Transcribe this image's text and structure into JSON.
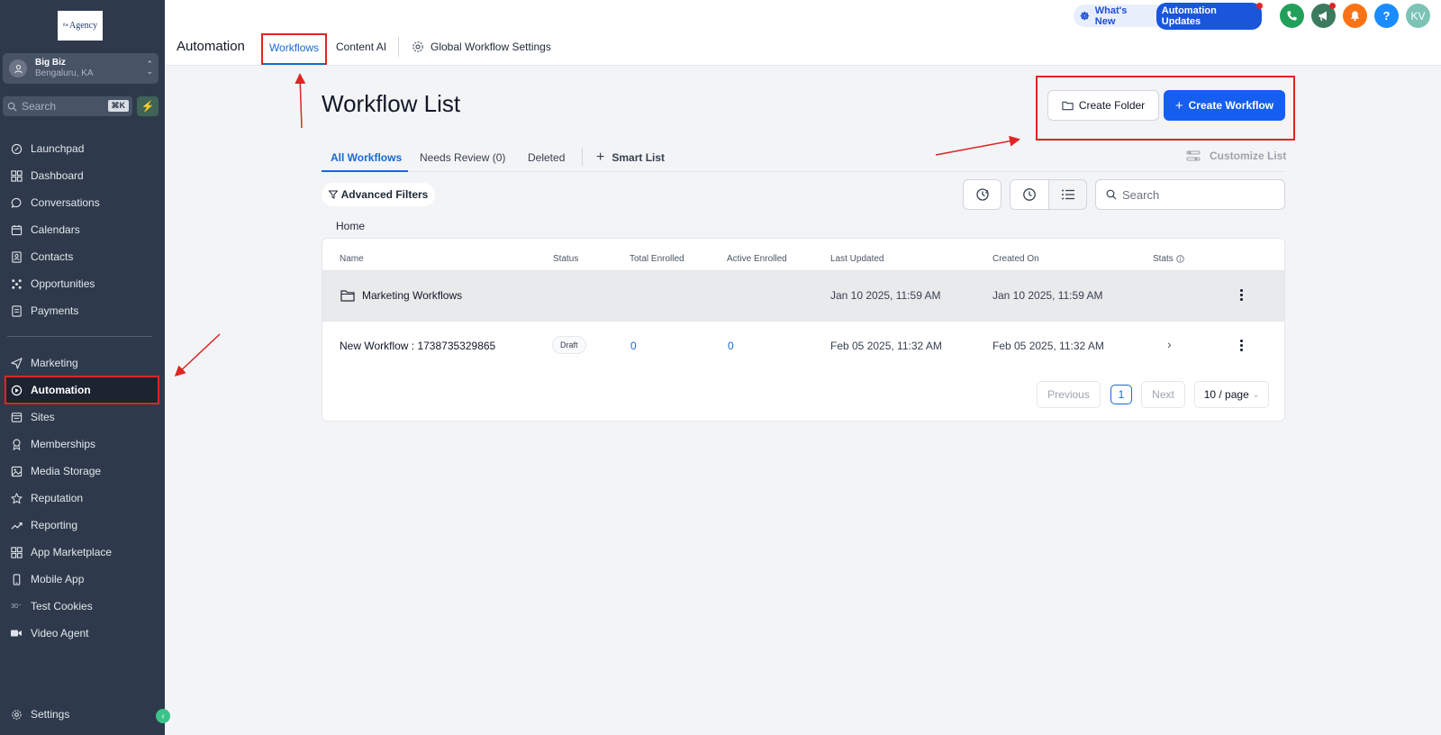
{
  "sidebar": {
    "logo_text": "Agency",
    "logo_sup": "the",
    "account": {
      "name": "Big Biz",
      "location": "Bengaluru, KA"
    },
    "search": {
      "placeholder": "Search",
      "shortcut": "⌘K"
    },
    "items": [
      {
        "label": "Launchpad",
        "icon": "rocket-icon"
      },
      {
        "label": "Dashboard",
        "icon": "dashboard-icon"
      },
      {
        "label": "Conversations",
        "icon": "chat-icon"
      },
      {
        "label": "Calendars",
        "icon": "calendar-icon"
      },
      {
        "label": "Contacts",
        "icon": "contacts-icon"
      },
      {
        "label": "Opportunities",
        "icon": "opportunities-icon"
      },
      {
        "label": "Payments",
        "icon": "payments-icon"
      },
      {
        "label": "Marketing",
        "icon": "send-icon"
      },
      {
        "label": "Automation",
        "icon": "automation-icon",
        "active": true
      },
      {
        "label": "Sites",
        "icon": "sites-icon"
      },
      {
        "label": "Memberships",
        "icon": "award-icon"
      },
      {
        "label": "Media Storage",
        "icon": "image-icon"
      },
      {
        "label": "Reputation",
        "icon": "star-icon"
      },
      {
        "label": "Reporting",
        "icon": "trend-icon"
      },
      {
        "label": "App Marketplace",
        "icon": "apps-icon"
      },
      {
        "label": "Mobile App",
        "icon": "mobile-icon"
      },
      {
        "label": "Test Cookies",
        "icon": "cookie-icon"
      },
      {
        "label": "Video Agent",
        "icon": "video-icon"
      }
    ],
    "settings_label": "Settings"
  },
  "topbar": {
    "page_label": "Automation",
    "tabs": [
      "Workflows",
      "Content AI",
      "Global Workflow Settings"
    ],
    "whats_new": "What's New",
    "automation_updates": "Automation Updates",
    "avatar_initials": "KV",
    "help_glyph": "?",
    "colors": {
      "phone": "#22a05a",
      "megaphone": "#3b7a5e",
      "bell": "#f97316",
      "help": "#1a8cff",
      "avatar": "#7cc3b6"
    }
  },
  "main": {
    "title": "Workflow List",
    "create_folder": "Create Folder",
    "create_workflow": "Create Workflow",
    "subtabs": [
      "All Workflows",
      "Needs Review (0)",
      "Deleted"
    ],
    "smart_list": "Smart List",
    "customize_list": "Customize List",
    "advanced_filters": "Advanced Filters",
    "search_placeholder": "Search",
    "breadcrumb": "Home",
    "table": {
      "headers": [
        "Name",
        "Status",
        "Total Enrolled",
        "Active Enrolled",
        "Last Updated",
        "Created On",
        "Stats"
      ],
      "folder_row": {
        "name": "Marketing Workflows",
        "last_updated": "Jan 10 2025, 11:59 AM",
        "created_on": "Jan 10 2025, 11:59 AM"
      },
      "workflow_row": {
        "name": "New Workflow : 1738735329865",
        "status": "Draft",
        "total_enrolled": "0",
        "active_enrolled": "0",
        "last_updated": "Feb 05 2025, 11:32 AM",
        "created_on": "Feb 05 2025, 11:32 AM"
      }
    },
    "pagination": {
      "previous": "Previous",
      "page": "1",
      "next": "Next",
      "page_size": "10 / page"
    }
  },
  "accent_colors": {
    "primary": "#155eef",
    "annotation_red": "#e02424",
    "sidebar_bg": "#2e3a4b"
  }
}
